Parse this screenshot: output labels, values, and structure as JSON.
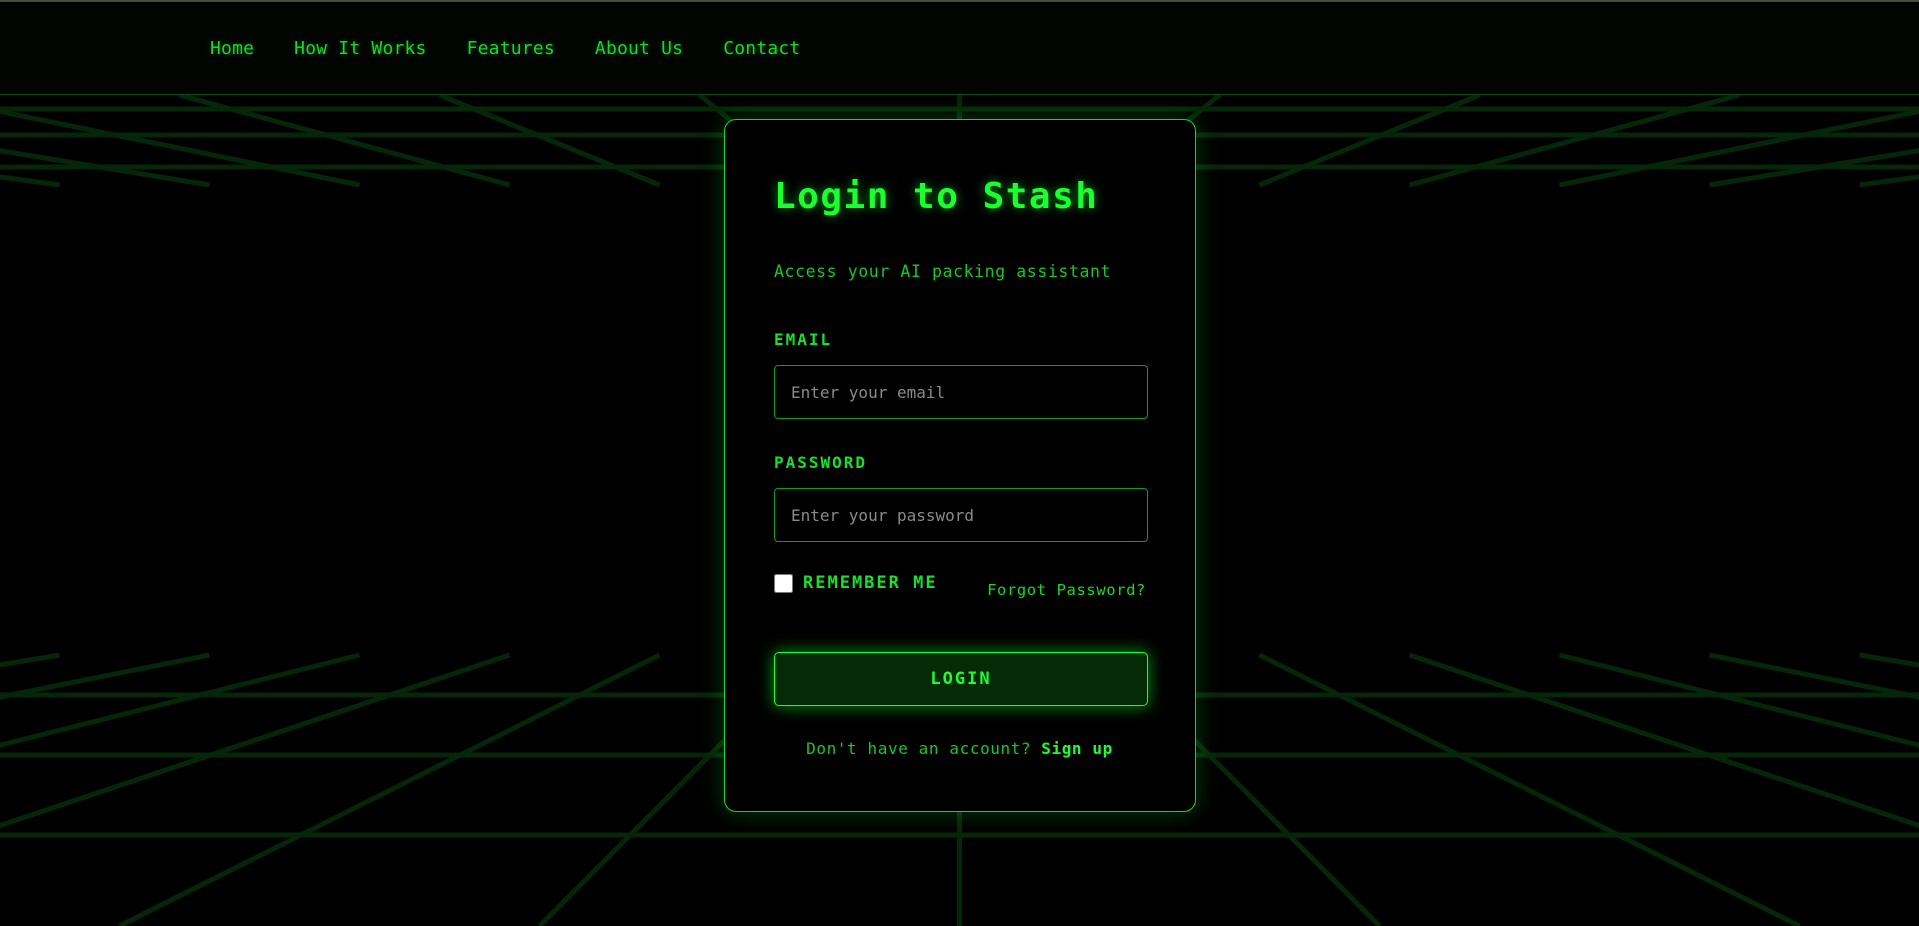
{
  "colors": {
    "accent": "#1aff2e",
    "background": "#000000",
    "border": "#17d42b",
    "button_fill": "#042a06",
    "grid_line": "#062d0a"
  },
  "nav": {
    "items": [
      {
        "label": "Home"
      },
      {
        "label": "How It Works"
      },
      {
        "label": "Features"
      },
      {
        "label": "About Us"
      },
      {
        "label": "Contact"
      }
    ]
  },
  "login": {
    "title": "Login to Stash",
    "subtitle": "Access your AI packing assistant",
    "email_label": "EMAIL",
    "email_placeholder": "Enter your email",
    "email_value": "",
    "password_label": "PASSWORD",
    "password_placeholder": "Enter your password",
    "password_value": "",
    "remember_label": "REMEMBER ME",
    "remember_checked": false,
    "forgot_label": "Forgot Password?",
    "submit_label": "LOGIN",
    "signup_prompt": "Don't have an account?",
    "signup_label": "Sign up"
  }
}
